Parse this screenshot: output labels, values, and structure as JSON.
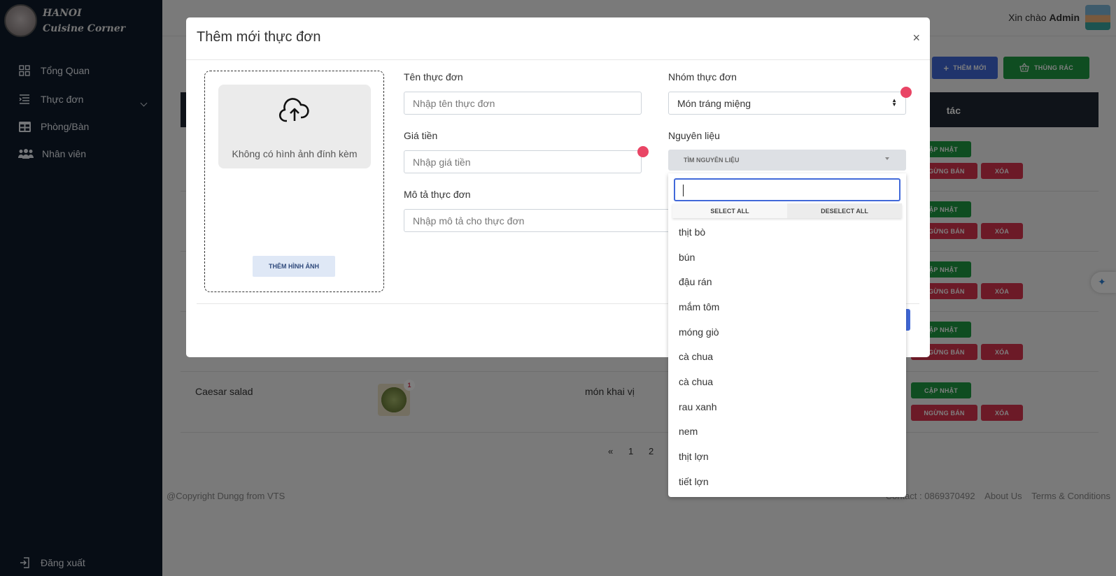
{
  "brand": {
    "line1": "HANOI",
    "line2": "Cuisine Corner"
  },
  "sidebar": {
    "items": [
      {
        "label": "Tổng Quan",
        "icon": "grid-icon"
      },
      {
        "label": "Thực đơn",
        "icon": "menu-list-icon"
      },
      {
        "label": "Phòng/Bàn",
        "icon": "table-icon"
      },
      {
        "label": "Nhân viên",
        "icon": "users-icon"
      }
    ],
    "logout": "Đăng xuất"
  },
  "header": {
    "greeting": "Xin chào",
    "user": "Admin"
  },
  "toolbar": {
    "add_label": "THÊM MỚI",
    "trash_label": "THÙNG RÁC"
  },
  "table": {
    "action_header": "tác",
    "row_buttons": {
      "update": "CẬP NHẬT",
      "stop": "NGỪNG BÁN",
      "delete": "XÓA"
    },
    "visible_row": {
      "name": "Caesar salad",
      "category": "món khai vị",
      "badge": "1"
    }
  },
  "pagination": {
    "prev": "«",
    "pages": [
      "1",
      "2"
    ]
  },
  "footer": {
    "copyright": "@Copyright Dungg from VTS",
    "contact": "Contact : 0869370492",
    "about": "About Us",
    "terms": "Terms & Conditions"
  },
  "modal": {
    "title": "Thêm mới thực đơn",
    "close": "×",
    "upload": {
      "empty_text": "Không có hình ảnh đính kèm",
      "button": "THÊM HÌNH ẢNH"
    },
    "fields": {
      "name_label": "Tên thực đơn",
      "name_placeholder": "Nhập tên thực đơn",
      "price_label": "Giá tiền",
      "price_placeholder": "Nhập giá tiền",
      "desc_label": "Mô tả thực đơn",
      "desc_placeholder": "Nhập mô tả cho thực đơn",
      "group_label": "Nhóm thực đơn",
      "group_value": "Món tráng miệng",
      "ingredients_label": "Nguyên liệu",
      "ingredients_button": "TÌM NGUYÊN LIỆU"
    }
  },
  "ingredients_dropdown": {
    "search_value": "",
    "select_all": "SELECT ALL",
    "deselect_all": "DESELECT ALL",
    "options": [
      "thịt bò",
      "bún",
      "đậu rán",
      "mắm tôm",
      "móng giò",
      "cà chua",
      "cà chua",
      "rau xanh",
      "nem",
      "thịt lợn",
      "tiết lợn"
    ]
  },
  "colors": {
    "sidebar_bg": "#0e1a2b",
    "primary": "#4169d9",
    "success": "#1f9a43",
    "danger": "#d9354f",
    "indicator": "#e94565"
  }
}
